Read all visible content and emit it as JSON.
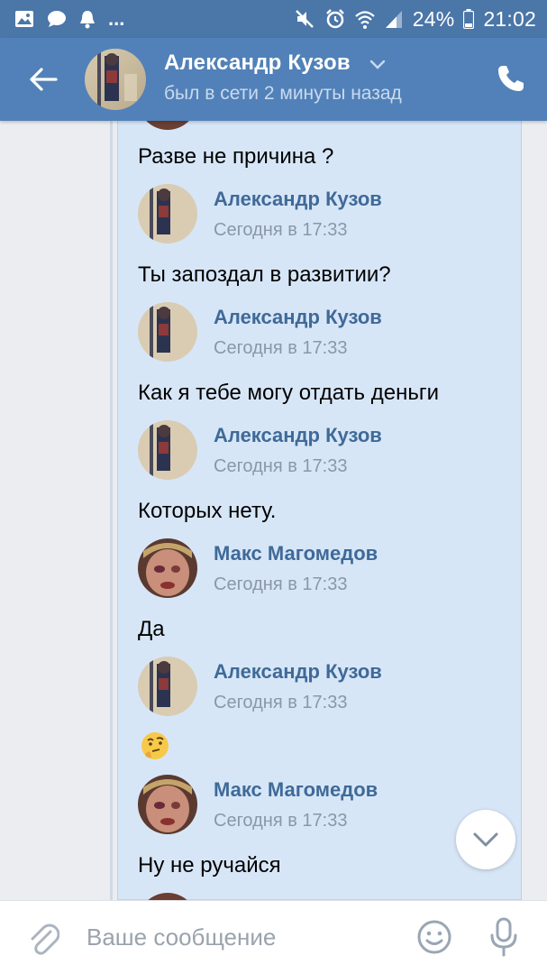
{
  "status_bar": {
    "battery_percent": "24%",
    "time": "21:02",
    "icons": [
      "image-icon",
      "chat-bubble-icon",
      "bell-icon",
      "more-dots-icon",
      "mute-icon",
      "alarm-icon",
      "wifi-icon",
      "signal-icon",
      "battery-icon"
    ],
    "more_dots": "..."
  },
  "header": {
    "title": "Александр Кузов",
    "subtitle": "был в сети 2 минуты назад",
    "icons": [
      "back-arrow-icon",
      "chevron-down-icon",
      "phone-icon"
    ]
  },
  "messages": [
    {
      "text": "Разве не причина ?"
    },
    {
      "author": "Александр Кузов",
      "time": "Сегодня в 17:33",
      "text": "Ты запоздал в развитии?"
    },
    {
      "author": "Александр Кузов",
      "time": "Сегодня в 17:33",
      "text": "Как я тебе могу отдать деньги"
    },
    {
      "author": "Александр Кузов",
      "time": "Сегодня в 17:33",
      "text": "Которых нету."
    },
    {
      "author": "Макс Магомедов",
      "time": "Сегодня в 17:33",
      "text": "Да"
    },
    {
      "author": "Александр Кузов",
      "time": "Сегодня в 17:33",
      "emoji": "thinking-face-emoji"
    },
    {
      "author": "Макс Магомедов",
      "time": "Сегодня в 17:33",
      "text": "Ну не ручайся"
    }
  ],
  "composer": {
    "placeholder": "Ваше сообщение",
    "value": "",
    "icons": [
      "paperclip-icon",
      "smile-icon",
      "microphone-icon"
    ]
  },
  "scroll_button": {
    "icon": "chevron-down-icon"
  },
  "colors": {
    "status_bar": "#4a76a8",
    "header": "#5181b8",
    "forward_panel": "#d7e6f7",
    "author_name": "#3f6a98",
    "timestamp": "#8a97a6"
  }
}
